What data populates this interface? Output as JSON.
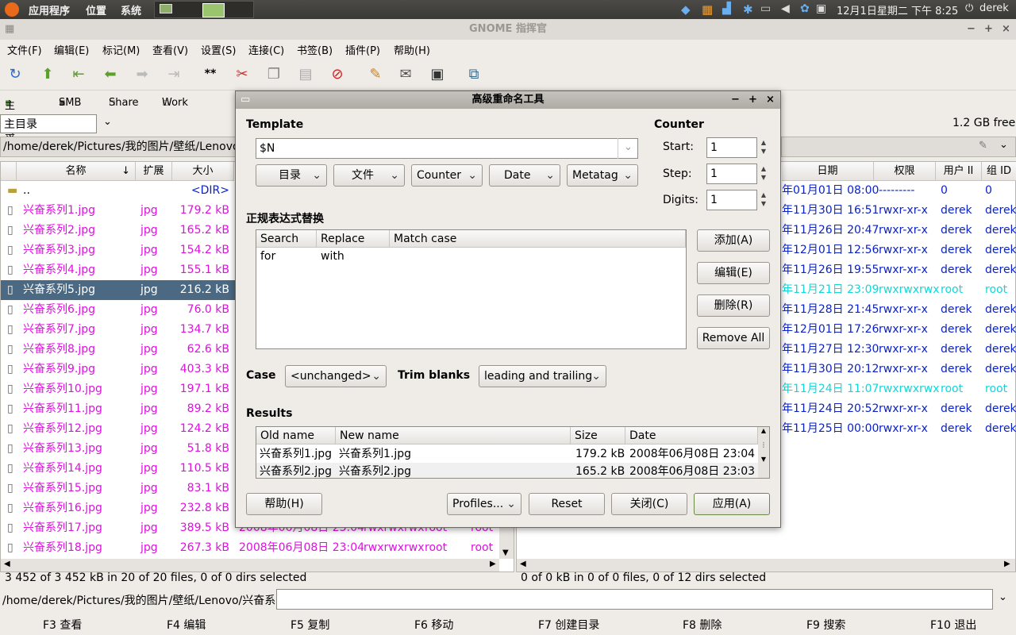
{
  "panel": {
    "apps": "应用程序",
    "places": "位置",
    "system": "系统",
    "datetime": "12月1日星期二 下午 8:25",
    "user": "derek"
  },
  "window": {
    "title": "GNOME 指挥官"
  },
  "menu": [
    "文件(F)",
    "编辑(E)",
    "标记(M)",
    "查看(V)",
    "设置(S)",
    "连接(C)",
    "书签(B)",
    "插件(P)",
    "帮助(H)"
  ],
  "bookmarks": [
    "主目录",
    "SMB",
    "Share",
    "Work"
  ],
  "left": {
    "location": "主目录",
    "path": "/home/derek/Pictures/我的图片/壁纸/Lenovo",
    "columns": [
      "名称",
      "扩展",
      "大小"
    ],
    "rows": [
      {
        "name": "..",
        "ext": "",
        "size": "<DIR>",
        "date": "",
        "perm": "",
        "user": "",
        "group": ""
      },
      {
        "name": "兴奋系列1.jpg",
        "ext": "jpg",
        "size": "179.2 kB",
        "date": "",
        "perm": "",
        "user": "",
        "group": ""
      },
      {
        "name": "兴奋系列2.jpg",
        "ext": "jpg",
        "size": "165.2 kB",
        "date": "",
        "perm": "",
        "user": "",
        "group": ""
      },
      {
        "name": "兴奋系列3.jpg",
        "ext": "jpg",
        "size": "154.2 kB",
        "date": "",
        "perm": "",
        "user": "",
        "group": ""
      },
      {
        "name": "兴奋系列4.jpg",
        "ext": "jpg",
        "size": "155.1 kB",
        "date": "",
        "perm": "",
        "user": "",
        "group": ""
      },
      {
        "name": "兴奋系列5.jpg",
        "ext": "jpg",
        "size": "216.2 kB",
        "date": "",
        "perm": "",
        "user": "",
        "group": ""
      },
      {
        "name": "兴奋系列6.jpg",
        "ext": "jpg",
        "size": "76.0 kB",
        "date": "",
        "perm": "",
        "user": "",
        "group": ""
      },
      {
        "name": "兴奋系列7.jpg",
        "ext": "jpg",
        "size": "134.7 kB",
        "date": "",
        "perm": "",
        "user": "",
        "group": ""
      },
      {
        "name": "兴奋系列8.jpg",
        "ext": "jpg",
        "size": "62.6 kB",
        "date": "",
        "perm": "",
        "user": "",
        "group": ""
      },
      {
        "name": "兴奋系列9.jpg",
        "ext": "jpg",
        "size": "403.3 kB",
        "date": "",
        "perm": "",
        "user": "",
        "group": ""
      },
      {
        "name": "兴奋系列10.jpg",
        "ext": "jpg",
        "size": "197.1 kB",
        "date": "",
        "perm": "",
        "user": "",
        "group": ""
      },
      {
        "name": "兴奋系列11.jpg",
        "ext": "jpg",
        "size": "89.2 kB",
        "date": "",
        "perm": "",
        "user": "",
        "group": ""
      },
      {
        "name": "兴奋系列12.jpg",
        "ext": "jpg",
        "size": "124.2 kB",
        "date": "",
        "perm": "",
        "user": "",
        "group": ""
      },
      {
        "name": "兴奋系列13.jpg",
        "ext": "jpg",
        "size": "51.8 kB",
        "date": "",
        "perm": "",
        "user": "",
        "group": ""
      },
      {
        "name": "兴奋系列14.jpg",
        "ext": "jpg",
        "size": "110.5 kB",
        "date": "",
        "perm": "",
        "user": "",
        "group": ""
      },
      {
        "name": "兴奋系列15.jpg",
        "ext": "jpg",
        "size": "83.1 kB",
        "date": "",
        "perm": "",
        "user": "",
        "group": ""
      },
      {
        "name": "兴奋系列16.jpg",
        "ext": "jpg",
        "size": "232.8 kB",
        "date": "",
        "perm": "",
        "user": "",
        "group": ""
      },
      {
        "name": "兴奋系列17.jpg",
        "ext": "jpg",
        "size": "389.5 kB",
        "date": "2008年06月08日 23:04",
        "perm": "rwxrwxrwx",
        "user": "root",
        "group": "root"
      },
      {
        "name": "兴奋系列18.jpg",
        "ext": "jpg",
        "size": "267.3 kB",
        "date": "2008年06月08日 23:04",
        "perm": "rwxrwxrwx",
        "user": "root",
        "group": "root"
      }
    ],
    "status": "3 452  of 3 452  kB in 20 of 20 files, 0 of 0 dirs selected"
  },
  "right": {
    "free": "1.2 GB free",
    "columns": [
      "日期",
      "权限",
      "用户 II",
      "组 ID"
    ],
    "rows": [
      {
        "date": "年01月01日 08:00",
        "perm": "---------",
        "user": "0",
        "group": "0"
      },
      {
        "date": "年11月30日 16:51",
        "perm": "rwxr-xr-x",
        "user": "derek",
        "group": "derek"
      },
      {
        "date": "年11月26日 20:47",
        "perm": "rwxr-xr-x",
        "user": "derek",
        "group": "derek"
      },
      {
        "date": "年12月01日 12:56",
        "perm": "rwxr-xr-x",
        "user": "derek",
        "group": "derek"
      },
      {
        "date": "年11月26日 19:55",
        "perm": "rwxr-xr-x",
        "user": "derek",
        "group": "derek"
      },
      {
        "date": "年11月21日 23:09",
        "perm": "rwxrwxrwx",
        "user": "root",
        "group": "root"
      },
      {
        "date": "年11月28日 21:45",
        "perm": "rwxr-xr-x",
        "user": "derek",
        "group": "derek"
      },
      {
        "date": "年12月01日 17:26",
        "perm": "rwxr-xr-x",
        "user": "derek",
        "group": "derek"
      },
      {
        "date": "年11月27日 12:30",
        "perm": "rwxr-xr-x",
        "user": "derek",
        "group": "derek"
      },
      {
        "date": "年11月30日 20:12",
        "perm": "rwxr-xr-x",
        "user": "derek",
        "group": "derek"
      },
      {
        "date": "年11月24日 11:07",
        "perm": "rwxrwxrwx",
        "user": "root",
        "group": "root"
      },
      {
        "date": "年11月24日 20:52",
        "perm": "rwxr-xr-x",
        "user": "derek",
        "group": "derek"
      },
      {
        "date": "年11月25日 00:00",
        "perm": "rwxr-xr-x",
        "user": "derek",
        "group": "derek"
      }
    ],
    "status": "0  of 0  kB in 0 of 0 files, 0 of 12 dirs selected"
  },
  "cmdline": {
    "prompt": "/home/derek/Pictures/我的图片/壁纸/Lenovo/兴奋系列 #",
    "value": ""
  },
  "fkeys": [
    "F3 查看",
    "F4 编辑",
    "F5 复制",
    "F6 移动",
    "F7 创建目录",
    "F8 删除",
    "F9 搜索",
    "F10 退出"
  ],
  "dialog": {
    "title": "高级重命名工具",
    "template_label": "Template",
    "template_value": "$N",
    "template_buttons": [
      "目录",
      "文件",
      "Counter",
      "Date",
      "Metatag"
    ],
    "counter_label": "Counter",
    "start_label": "Start:",
    "start_value": "1",
    "step_label": "Step:",
    "step_value": "1",
    "digits_label": "Digits:",
    "digits_value": "1",
    "regex_label": "正规表达式替换",
    "regex_columns": [
      "Search for",
      "Replace with",
      "Match case"
    ],
    "regex_buttons": [
      "添加(A)",
      "编辑(E)",
      "删除(R)",
      "Remove All"
    ],
    "case_label": "Case",
    "case_value": "<unchanged>",
    "trim_label": "Trim blanks",
    "trim_value": "leading and trailing",
    "results_label": "Results",
    "results_columns": [
      "Old name",
      "New name",
      "Size",
      "Date"
    ],
    "results_rows": [
      {
        "old": "兴奋系列1.jpg",
        "new": "兴奋系列1.jpg",
        "size": "179.2 kB",
        "date": "2008年06月08日 23:04"
      },
      {
        "old": "兴奋系列2.jpg",
        "new": "兴奋系列2.jpg",
        "size": "165.2 kB",
        "date": "2008年06月08日 23:03"
      }
    ],
    "help_button": "帮助(H)",
    "profiles_button": "Profiles...",
    "reset_button": "Reset",
    "close_button": "关闭(C)",
    "apply_button": "应用(A)"
  }
}
